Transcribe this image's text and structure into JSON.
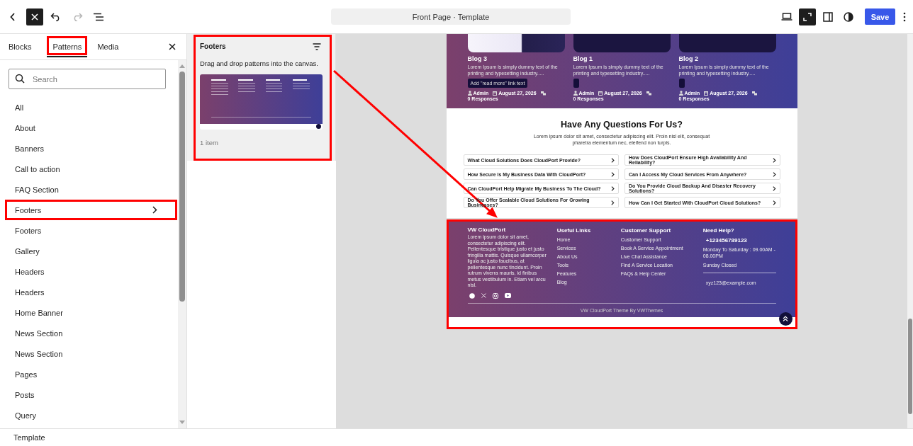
{
  "toolbar": {
    "document_title": "Front Page · Template",
    "save_label": "Save"
  },
  "inserter": {
    "tabs": [
      {
        "label": "Blocks",
        "selected": false,
        "highlighted": false
      },
      {
        "label": "Patterns",
        "selected": true,
        "highlighted": true
      },
      {
        "label": "Media",
        "selected": false,
        "highlighted": false
      }
    ],
    "search": {
      "placeholder": "Search"
    },
    "categories": [
      {
        "label": "All",
        "selected": false,
        "highlighted": false
      },
      {
        "label": "About",
        "selected": false,
        "highlighted": false
      },
      {
        "label": "Banners",
        "selected": false,
        "highlighted": false
      },
      {
        "label": "Call to action",
        "selected": false,
        "highlighted": false
      },
      {
        "label": "FAQ Section",
        "selected": false,
        "highlighted": false
      },
      {
        "label": "Footers",
        "selected": true,
        "highlighted": true
      },
      {
        "label": "Footers",
        "selected": false,
        "highlighted": false
      },
      {
        "label": "Gallery",
        "selected": false,
        "highlighted": false
      },
      {
        "label": "Headers",
        "selected": false,
        "highlighted": false
      },
      {
        "label": "Headers",
        "selected": false,
        "highlighted": false
      },
      {
        "label": "Home Banner",
        "selected": false,
        "highlighted": false
      },
      {
        "label": "News Section",
        "selected": false,
        "highlighted": false
      },
      {
        "label": "News Section",
        "selected": false,
        "highlighted": false
      },
      {
        "label": "Pages",
        "selected": false,
        "highlighted": false
      },
      {
        "label": "Posts",
        "selected": false,
        "highlighted": false
      },
      {
        "label": "Query",
        "selected": false,
        "highlighted": false
      }
    ]
  },
  "pattern_panel": {
    "title": "Footers",
    "description": "Drag and drop patterns into the canvas.",
    "count": "1 item",
    "highlighted": true
  },
  "canvas": {
    "blog_posts": [
      {
        "title": "Blog 3",
        "excerpt": "Lorem Ipsum is simply dummy text of the printing and typesetting industry.....",
        "read_more": "Add \"read more\" link text",
        "author": "Admin",
        "date": "August 27, 2026",
        "responses": "0 Responses"
      },
      {
        "title": "Blog 1",
        "excerpt": "Lorem Ipsum is simply dummy text of the printing and typesetting industry.....",
        "author": "Admin",
        "date": "August 27, 2026",
        "responses": "0 Responses"
      },
      {
        "title": "Blog 2",
        "excerpt": "Lorem Ipsum is simply dummy text of the printing and typesetting industry.....",
        "author": "Admin",
        "date": "August 27, 2026",
        "responses": "0 Responses"
      }
    ],
    "faq": {
      "heading": "Have Any Questions For Us?",
      "intro": "Lorem ipsum dolor sit amet, consectetur adipiscing elit. Proin nisl elit, consequat pharetra elementum nec, eleifend non turpis.",
      "questions": [
        "What Cloud Solutions Does CloudPort Provide?",
        "How Does CloudPort Ensure High Availability And Reliability?",
        "How Secure Is My Business Data With CloudPort?",
        "Can I Access My Cloud Services From Anywhere?",
        "Can CloudPort Help Migrate My Business To The Cloud?",
        "Do You Provide Cloud Backup And Disaster Recovery Solutions?",
        "Do You Offer Scalable Cloud Solutions For Growing Businesses?",
        "How Can I Get Started With CloudPort Cloud Solutions?"
      ]
    },
    "footer": {
      "highlighted": true,
      "brand": "VW CloudPort",
      "about": "Lorem ipsum dolor sit amet, consectetur adipiscing elit. Pellentesque tristique justo et justo fringilla mattis. Quisque ullamcorper ligula ac justo faucibus, at pellentesque nunc tincidunt. Proin rutrum viverra mauris, id finibus metus vestibulum in. Etiam vel arcu nisl.",
      "link_columns": [
        {
          "heading": "Useful Links",
          "links": [
            "Home",
            "Services",
            "About Us",
            "Tools",
            "Features",
            "Blog"
          ]
        },
        {
          "heading": "Customer Support",
          "links": [
            "Customer Support",
            "Book A Service Appointment",
            "Live Chat Assistance",
            "Find A Service Location",
            "FAQs & Help Center"
          ]
        }
      ],
      "help": {
        "heading": "Need Help?",
        "phone": "+123456789123",
        "hours": "Monday To Saturday : 09.00AM - 08.00PM",
        "closed": "Sunday Closed",
        "email": "xyz123@example.com"
      },
      "copyright": "VW CloudPort Theme By VWThemes"
    }
  },
  "status_bar": {
    "breadcrumb": "Template"
  }
}
